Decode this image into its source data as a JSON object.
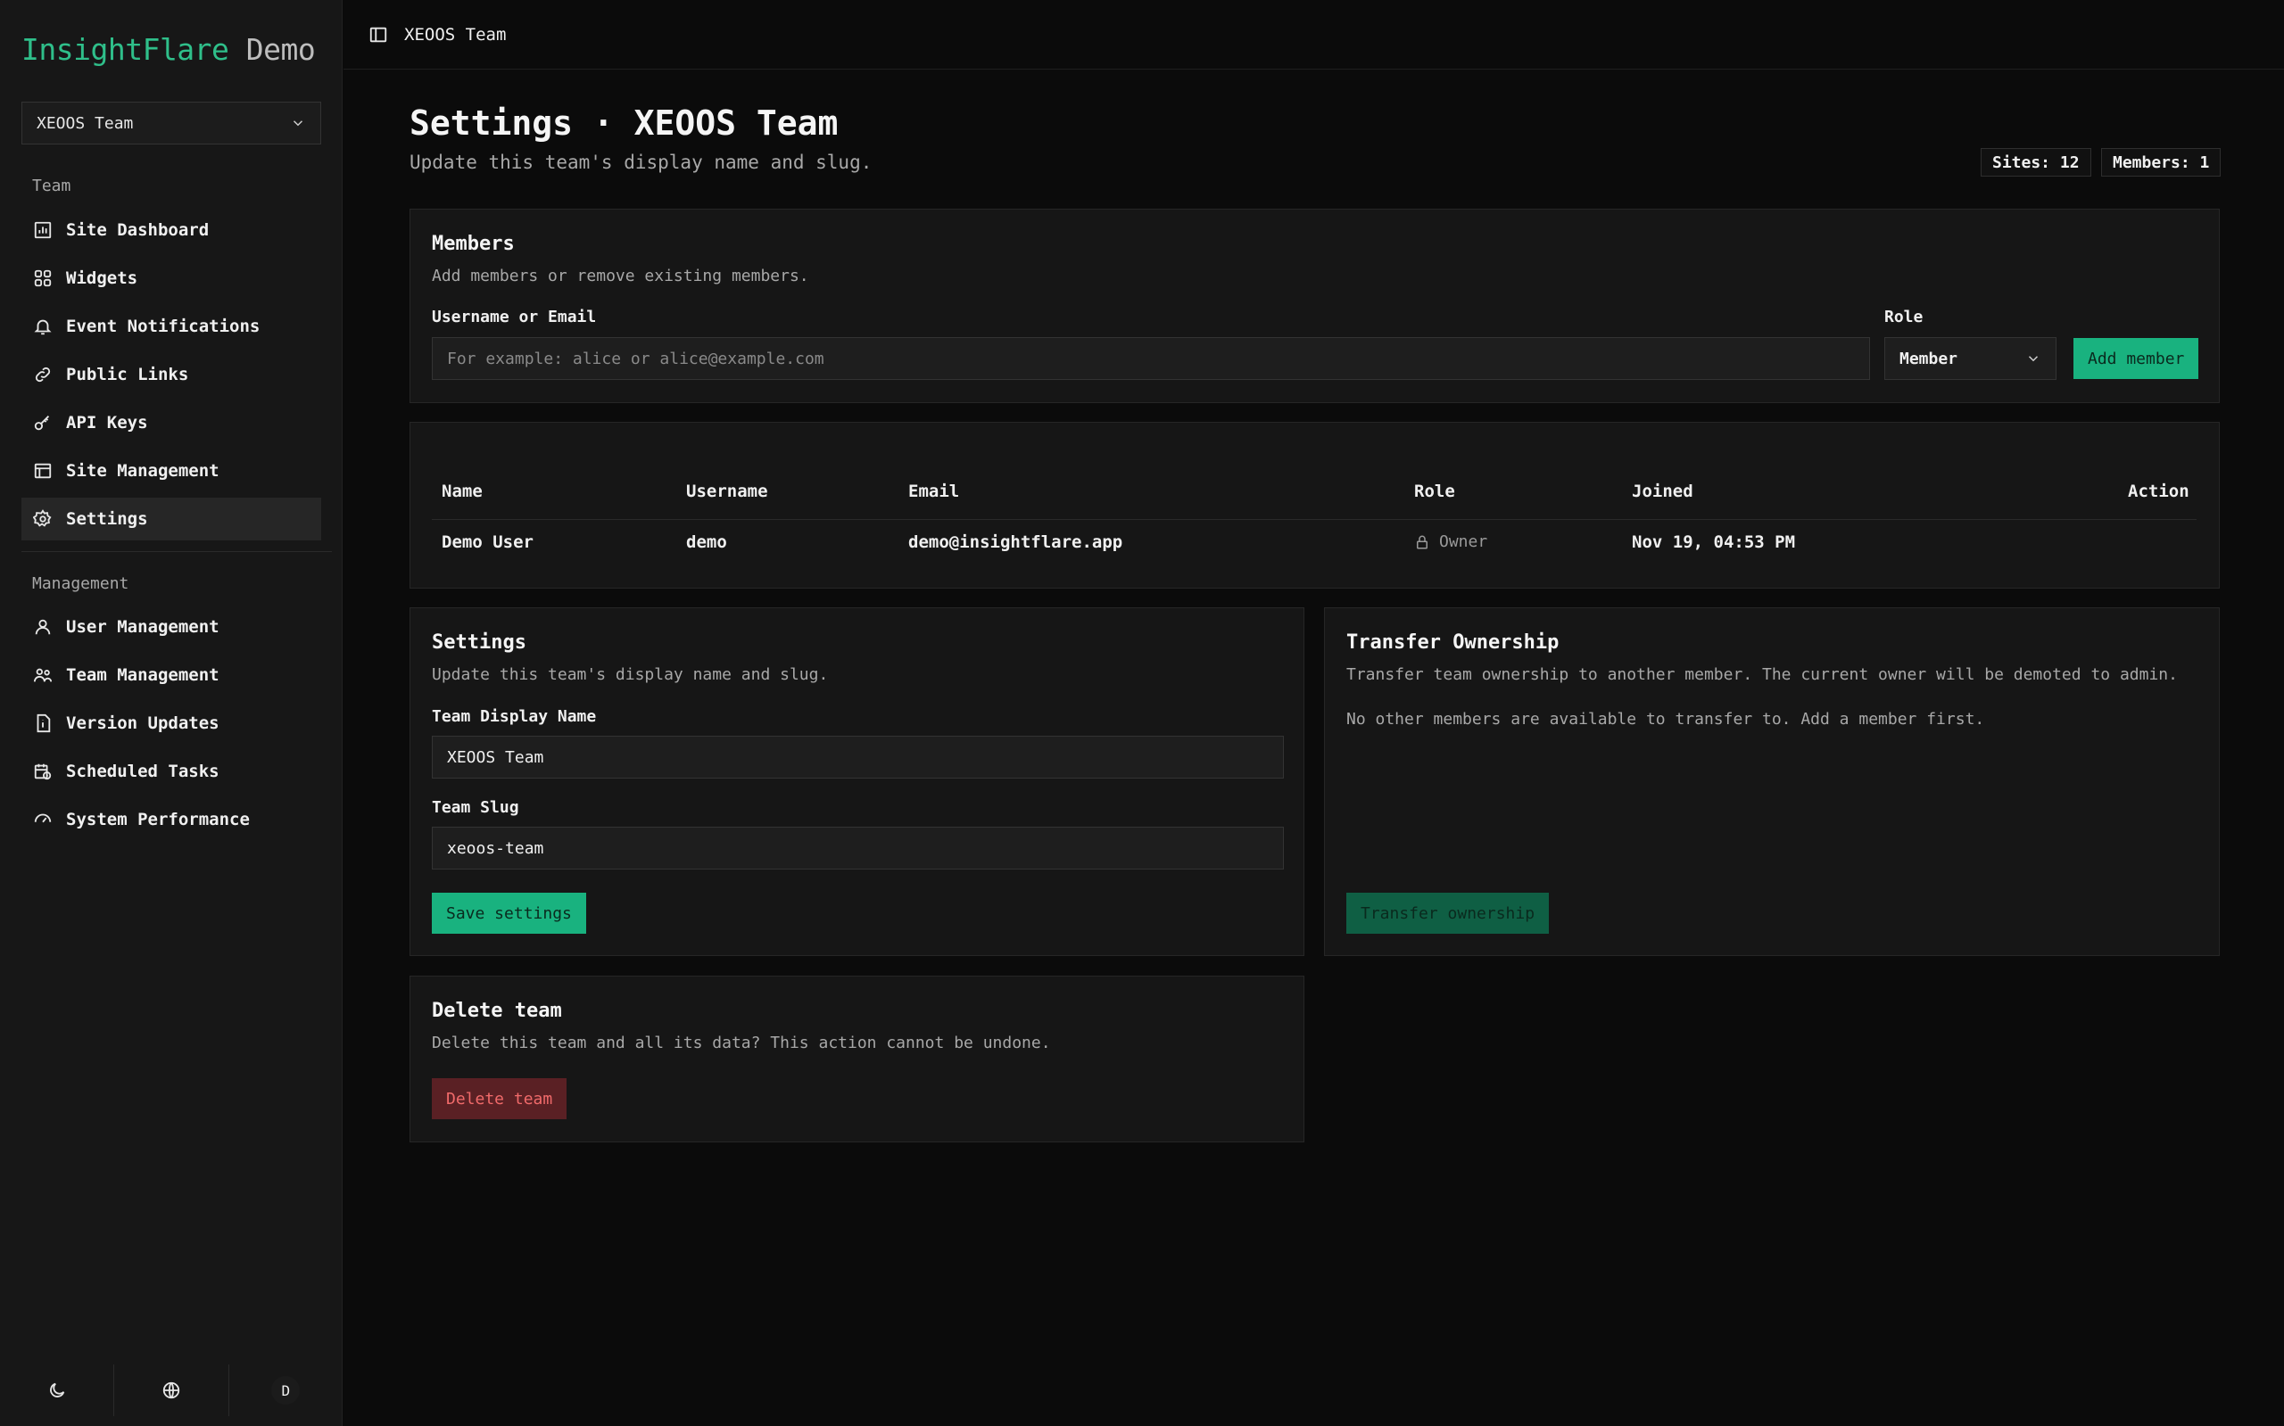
{
  "sidebar": {
    "brand_primary": "InsightFlare",
    "brand_secondary": "Demo",
    "team_select": "XEOOS Team",
    "section_team": "Team",
    "team_items": [
      {
        "label": "Site Dashboard",
        "icon": "chart-icon"
      },
      {
        "label": "Widgets",
        "icon": "widgets-icon"
      },
      {
        "label": "Event Notifications",
        "icon": "bell-icon"
      },
      {
        "label": "Public Links",
        "icon": "link-icon"
      },
      {
        "label": "API Keys",
        "icon": "key-icon"
      },
      {
        "label": "Site Management",
        "icon": "browser-icon"
      },
      {
        "label": "Settings",
        "icon": "gear-icon",
        "active": true
      }
    ],
    "section_management": "Management",
    "management_items": [
      {
        "label": "User Management",
        "icon": "user-icon"
      },
      {
        "label": "Team Management",
        "icon": "users-icon"
      },
      {
        "label": "Version Updates",
        "icon": "file-info-icon"
      },
      {
        "label": "Scheduled Tasks",
        "icon": "calendar-clock-icon"
      },
      {
        "label": "System Performance",
        "icon": "gauge-icon"
      }
    ],
    "avatar_initial": "D"
  },
  "topbar": {
    "breadcrumb": "XEOOS Team"
  },
  "page": {
    "title": "Settings · XEOOS Team",
    "subtitle": "Update this team's display name and slug.",
    "sites_badge": "Sites: 12",
    "members_badge": "Members: 1"
  },
  "members": {
    "title": "Members",
    "description": "Add members or remove existing members.",
    "username_label": "Username or Email",
    "username_placeholder": "For example: alice or alice@example.com",
    "role_label": "Role",
    "role_value": "Member",
    "add_button": "Add member"
  },
  "table": {
    "headers": [
      "Name",
      "Username",
      "Email",
      "Role",
      "Joined",
      "Action"
    ],
    "rows": [
      {
        "name": "Demo User",
        "username": "demo",
        "email": "demo@insightflare.app",
        "role": "Owner",
        "joined": "Nov 19, 04:53 PM"
      }
    ]
  },
  "settings": {
    "title": "Settings",
    "description": "Update this team's display name and slug.",
    "display_name_label": "Team Display Name",
    "display_name_value": "XEOOS Team",
    "slug_label": "Team Slug",
    "slug_value": "xeoos-team",
    "save_button": "Save settings"
  },
  "transfer": {
    "title": "Transfer Ownership",
    "description": "Transfer team ownership to another member. The current owner will be demoted to admin.",
    "note": "No other members are available to transfer to. Add a member first.",
    "button": "Transfer ownership"
  },
  "delete": {
    "title": "Delete team",
    "description": "Delete this team and all its data? This action cannot be undone.",
    "button": "Delete team"
  },
  "colors": {
    "accent": "#19b27f",
    "danger": "#f06a6a"
  }
}
